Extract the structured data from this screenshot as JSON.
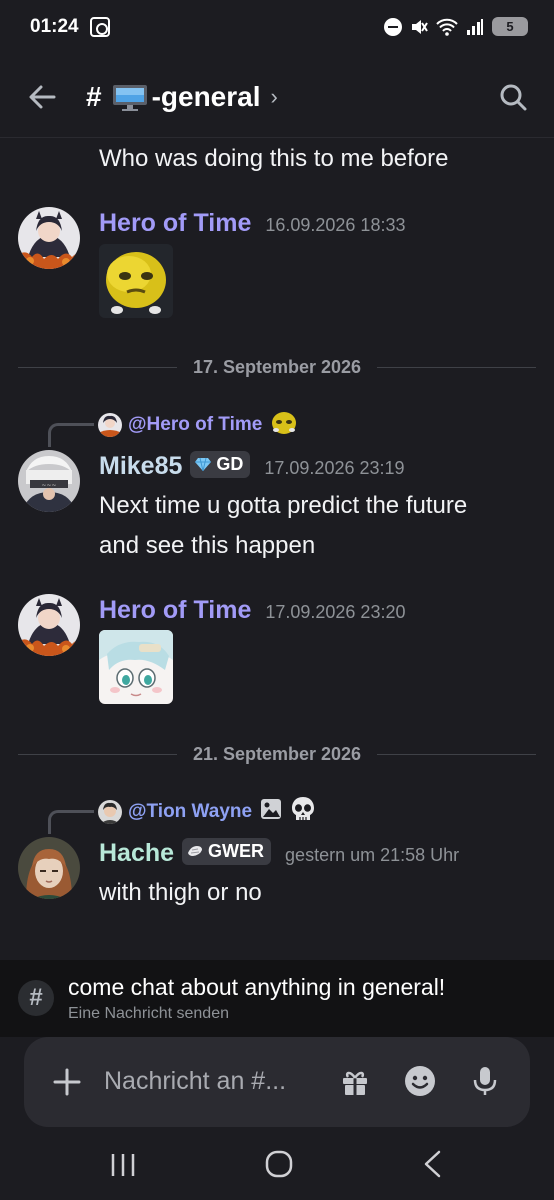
{
  "status_bar": {
    "time": "01:24",
    "battery": "5"
  },
  "header": {
    "channel_hash": "#",
    "channel_name": "-general",
    "chevron": "›"
  },
  "messages": [
    {
      "type": "text",
      "text": "Who was doing this to me before"
    },
    {
      "type": "message",
      "author": "Hero of Time",
      "author_color": "#a29bf7",
      "timestamp": "16.09.2026 18:33"
    },
    {
      "type": "divider",
      "label": "17. September 2026"
    },
    {
      "type": "message",
      "reply_to": "@Hero of Time",
      "reply_color": "#a29bf7",
      "author": "Mike85",
      "author_color": "#c8dcec",
      "tag": "GD",
      "timestamp": "17.09.2026 23:19",
      "lines": [
        "Next time u gotta predict the future",
        "and see this happen"
      ]
    },
    {
      "type": "message",
      "author": "Hero of Time",
      "author_color": "#a29bf7",
      "timestamp": "17.09.2026 23:20"
    },
    {
      "type": "divider",
      "label": "21. September 2026"
    },
    {
      "type": "message",
      "reply_to": "@Tion Wayne",
      "reply_color": "#8ea1f3",
      "author": "Hache",
      "author_color": "#b8e8d8",
      "tag": "GWER",
      "timestamp": "gestern um 21:58 Uhr",
      "lines": [
        "with thigh or no"
      ]
    }
  ],
  "topic": {
    "hash": "#",
    "title": "come chat about anything in general!",
    "subtitle": "Eine Nachricht senden"
  },
  "composer": {
    "placeholder": "Nachricht an #..."
  },
  "colors": {
    "background": "#1c1c21",
    "topic_bar": "#121214",
    "composer": "#2b2b31"
  }
}
